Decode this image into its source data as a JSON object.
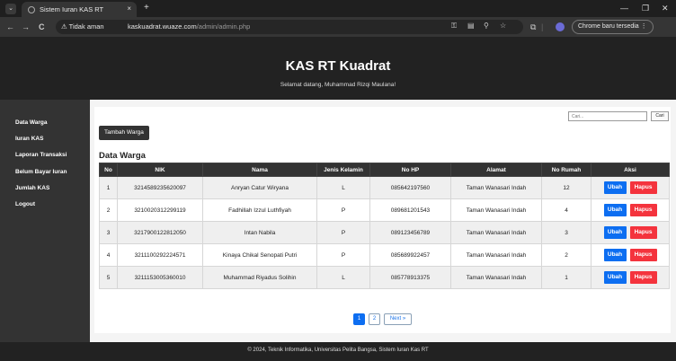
{
  "browser": {
    "tab_title": "Sistem Iuran KAS RT",
    "tab_close": "×",
    "new_tab": "+",
    "menu_glyph": "⌄",
    "back": "←",
    "forward": "→",
    "reload": "C",
    "security_warning": "⚠ Tidak aman",
    "url_host": "kaskuadrat.wuaze.com",
    "url_path": "/admin/admin.php",
    "chrome_update": "Chrome baru tersedia ⋮",
    "minimize": "—",
    "restore": "❐",
    "close": "✕"
  },
  "header": {
    "title": "KAS RT Kuadrat",
    "welcome": "Selamat datang, Muhammad Rizqi Maulana!"
  },
  "sidebar": {
    "items": [
      {
        "label": "Data Warga"
      },
      {
        "label": "Iuran KAS"
      },
      {
        "label": "Laporan Transaksi"
      },
      {
        "label": "Belum Bayar Iuran"
      },
      {
        "label": "Jumlah KAS"
      },
      {
        "label": "Logout"
      }
    ]
  },
  "toolbar": {
    "add_label": "Tambah Warga",
    "search_placeholder": "Cari...",
    "search_label": "Cari"
  },
  "section": {
    "title": "Data Warga"
  },
  "table": {
    "headers": [
      "No",
      "NIK",
      "Nama",
      "Jenis Kelamin",
      "No HP",
      "Alamat",
      "No Rumah",
      "Aksi"
    ],
    "rows": [
      {
        "no": "1",
        "nik": "3214589235620097",
        "nama": "Anryan Catur Wiryana",
        "jk": "L",
        "hp": "085642197560",
        "alamat": "Taman Wanasari Indah",
        "rumah": "12"
      },
      {
        "no": "2",
        "nik": "3210020312299119",
        "nama": "Fadhillah Izzul Luthfiyah",
        "jk": "P",
        "hp": "089681201543",
        "alamat": "Taman Wanasari Indah",
        "rumah": "4"
      },
      {
        "no": "3",
        "nik": "3217900122812050",
        "nama": "Intan Nabila",
        "jk": "P",
        "hp": "089123456789",
        "alamat": "Taman Wanasari Indah",
        "rumah": "3"
      },
      {
        "no": "4",
        "nik": "3211100292224571",
        "nama": "Kinaya Chikal Senopati Putri",
        "jk": "P",
        "hp": "085689922457",
        "alamat": "Taman Wanasari Indah",
        "rumah": "2"
      },
      {
        "no": "5",
        "nik": "3211153005360010",
        "nama": "Muhammad Riyadus Solihin",
        "jk": "L",
        "hp": "085778913375",
        "alamat": "Taman Wanasari Indah",
        "rumah": "1"
      }
    ],
    "edit_label": "Ubah",
    "delete_label": "Hapus"
  },
  "pagination": {
    "pages": [
      "1",
      "2"
    ],
    "current": "1",
    "next_label": "Next »"
  },
  "footer": {
    "text": "© 2024, Teknik Informatika, Universitas Pelita Bangsa, Sistem Iuran Kas RT"
  },
  "colors": {
    "primary": "#0d6ef1",
    "danger": "#f4333d",
    "dark": "#222222"
  }
}
